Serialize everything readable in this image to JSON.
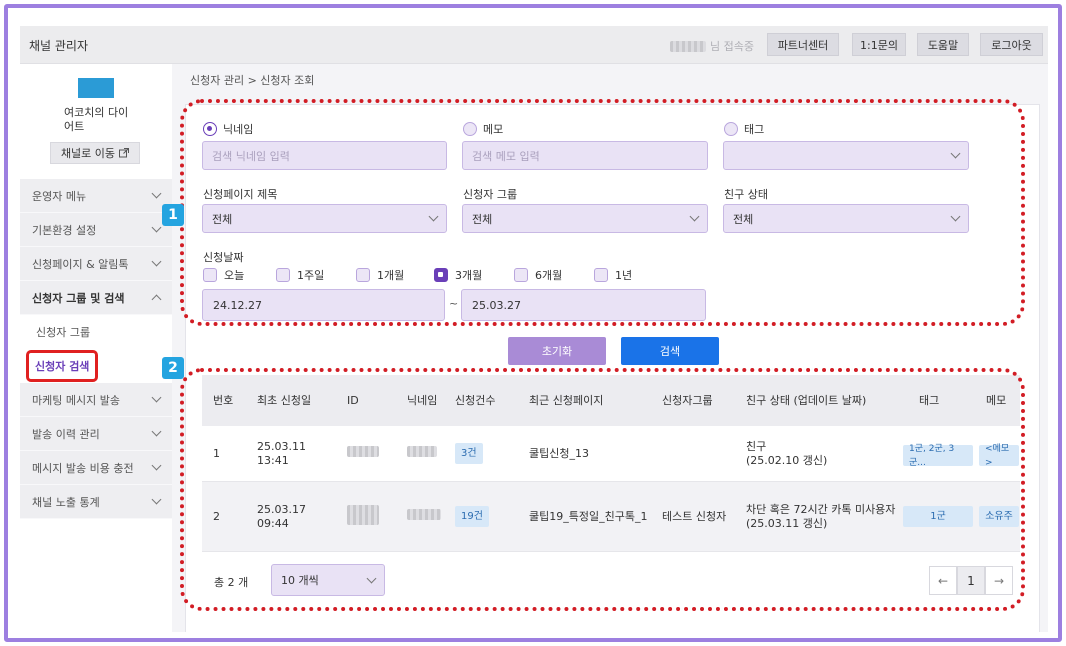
{
  "header": {
    "title": "채널 관리자",
    "user_suffix": "님 접속중",
    "buttons": [
      "파트너센터",
      "1:1문의",
      "도움말",
      "로그아웃"
    ]
  },
  "sidebar": {
    "brand_name": "여코치의 다이어트",
    "channel_button": "채널로 이동",
    "menu": [
      {
        "label": "운영자 메뉴"
      },
      {
        "label": "기본환경 설정"
      },
      {
        "label": "신청페이지 & 알림톡"
      },
      {
        "label": "신청자 그룹 및 검색"
      },
      {
        "label": "신청자 그룹"
      },
      {
        "label": "신청자 검색"
      },
      {
        "label": "마케팅 메시지 발송"
      },
      {
        "label": "발송 이력 관리"
      },
      {
        "label": "메시지 발송 비용 충전"
      },
      {
        "label": "채널 노출 통계"
      }
    ]
  },
  "breadcrumb": "신청자 관리 > 신청자 조회",
  "markers": [
    "1",
    "2"
  ],
  "filters": {
    "nickname_label": "닉네임",
    "nickname_placeholder": "검색 닉네임 입력",
    "memo_label": "메모",
    "memo_placeholder": "검색 메모 입력",
    "tag_label": "태그",
    "page_title_label": "신청페이지 제목",
    "page_title_value": "전체",
    "group_label": "신청자 그룹",
    "group_value": "전체",
    "friend_label": "친구 상태",
    "friend_value": "전체",
    "date_label": "신청날짜",
    "periods": [
      "오늘",
      "1주일",
      "1개월",
      "3개월",
      "6개월",
      "1년"
    ],
    "selected_period": "3개월",
    "date_from": "24.12.27",
    "date_sep": "~",
    "date_to": "25.03.27"
  },
  "actions": {
    "reset": "초기화",
    "search": "검색"
  },
  "table": {
    "headers": [
      "번호",
      "최초 신청일",
      "ID",
      "닉네임",
      "신청건수",
      "최근 신청페이지",
      "신청자그룹",
      "친구 상태 (업데이트 날짜)",
      "태그",
      "메모"
    ],
    "rows": [
      {
        "no": "1",
        "date": "25.03.11",
        "time": "13:41",
        "count": "3건",
        "page": "쿨팁신청_13",
        "group": "",
        "friend": "친구",
        "friend_date": "(25.02.10 갱신)",
        "tag": "1군, 2군, 3군...",
        "memo": "<메모>"
      },
      {
        "no": "2",
        "date": "25.03.17",
        "time": "09:44",
        "count": "19건",
        "page": "쿨팁19_특정일_친구톡_1",
        "group": "테스트 신청자",
        "friend": "차단 혹은 72시간 카톡 미사용자",
        "friend_date": "(25.03.11 갱신)",
        "tag": "1군",
        "memo": "소유주"
      }
    ]
  },
  "footer": {
    "total": "총 2 개",
    "page_size": "10 개씩",
    "current_page": "1",
    "prev_icon": "←",
    "next_icon": "→"
  },
  "colors": {
    "accent": "#6a3fb8",
    "search_button": "#1a73e8",
    "reset_button": "#a98bd6",
    "marker": "#24a4e0",
    "outline": "#d21d25"
  }
}
